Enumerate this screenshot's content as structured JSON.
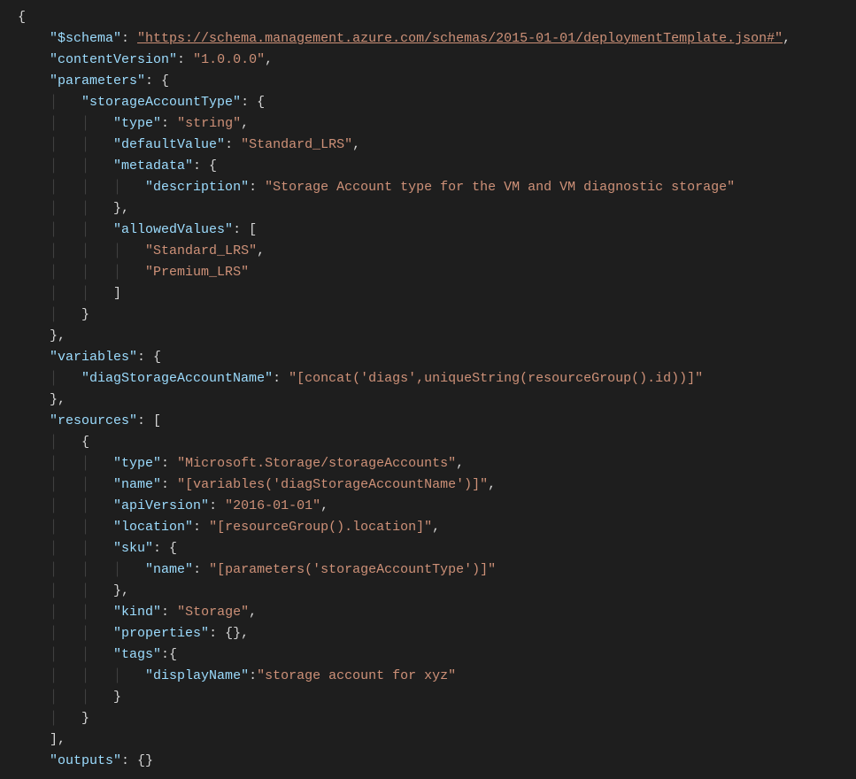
{
  "code": {
    "schema_key": "\"$schema\"",
    "schema_val": "\"https://schema.management.azure.com/schemas/2015-01-01/deploymentTemplate.json#\"",
    "contentVersion_key": "\"contentVersion\"",
    "contentVersion_val": "\"1.0.0.0\"",
    "parameters_key": "\"parameters\"",
    "storageAccountType_key": "\"storageAccountType\"",
    "type_key": "\"type\"",
    "type_string_val": "\"string\"",
    "defaultValue_key": "\"defaultValue\"",
    "defaultValue_val": "\"Standard_LRS\"",
    "metadata_key": "\"metadata\"",
    "description_key": "\"description\"",
    "description_val": "\"Storage Account type for the VM and VM diagnostic storage\"",
    "allowedValues_key": "\"allowedValues\"",
    "allowed_0": "\"Standard_LRS\"",
    "allowed_1": "\"Premium_LRS\"",
    "variables_key": "\"variables\"",
    "diagStorageAccountName_key": "\"diagStorageAccountName\"",
    "diagStorageAccountName_val": "\"[concat('diags',uniqueString(resourceGroup().id))]\"",
    "resources_key": "\"resources\"",
    "res_type_val": "\"Microsoft.Storage/storageAccounts\"",
    "name_key": "\"name\"",
    "res_name_val": "\"[variables('diagStorageAccountName')]\"",
    "apiVersion_key": "\"apiVersion\"",
    "apiVersion_val": "\"2016-01-01\"",
    "location_key": "\"location\"",
    "location_val": "\"[resourceGroup().location]\"",
    "sku_key": "\"sku\"",
    "sku_name_val": "\"[parameters('storageAccountType')]\"",
    "kind_key": "\"kind\"",
    "kind_val": "\"Storage\"",
    "properties_key": "\"properties\"",
    "tags_key": "\"tags\"",
    "displayName_key": "\"displayName\"",
    "displayName_val": "\"storage account for xyz\"",
    "outputs_key": "\"outputs\""
  }
}
